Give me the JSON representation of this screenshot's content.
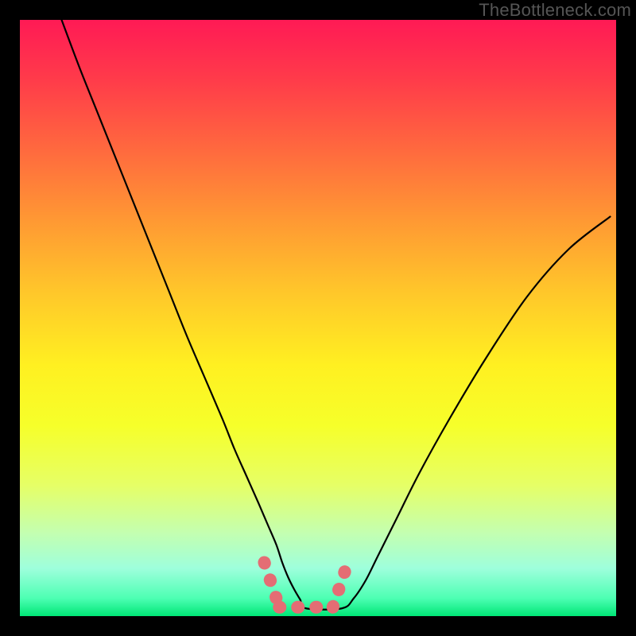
{
  "watermark": "TheBottleneck.com",
  "colors": {
    "frame": "#000000",
    "curve": "#000000",
    "marker": "#e46d74",
    "gradient_top": "#ff1a55",
    "gradient_bottom": "#00e676"
  },
  "chart_data": {
    "type": "line",
    "title": "",
    "xlabel": "",
    "ylabel": "",
    "xlim": [
      0,
      100
    ],
    "ylim": [
      0,
      100
    ],
    "series": [
      {
        "name": "curve",
        "x": [
          7,
          10,
          13,
          16,
          19,
          22,
          25,
          28,
          31,
          34,
          36,
          38,
          40,
          41.5,
          43,
          44,
          45,
          46,
          47,
          48,
          54,
          56,
          58,
          60,
          63,
          67,
          72,
          78,
          85,
          92,
          99
        ],
        "y": [
          100,
          92,
          84.5,
          77,
          69.5,
          62,
          54.5,
          47,
          40,
          33,
          28,
          23.5,
          19,
          15.5,
          12,
          9,
          6.5,
          4.5,
          2.8,
          1.3,
          1.3,
          3,
          6,
          10,
          16,
          24,
          33,
          43,
          53.5,
          61.5,
          67
        ]
      }
    ],
    "markers": {
      "segments": [
        {
          "x1": 41,
          "y1": 9,
          "x2": 43.5,
          "y2": 1.5
        },
        {
          "x1": 43.5,
          "y1": 1.5,
          "x2": 52.5,
          "y2": 1.5
        },
        {
          "x1": 52.5,
          "y1": 1.5,
          "x2": 55,
          "y2": 9
        }
      ]
    }
  }
}
